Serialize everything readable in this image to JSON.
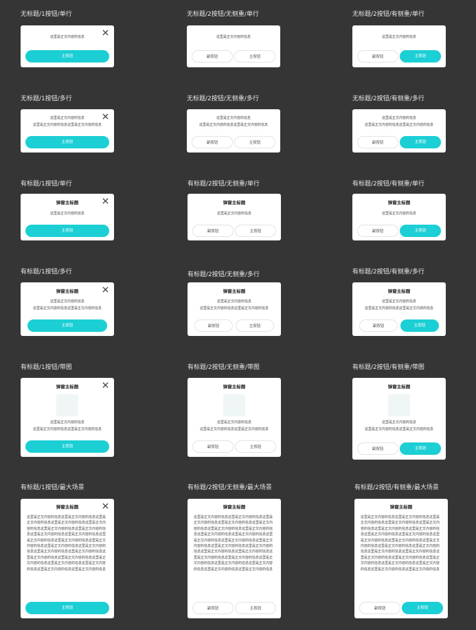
{
  "labels": {
    "r1c1": "无标题/1按钮/单行",
    "r1c2": "无标题/2按钮/无侧重/单行",
    "r1c3": "无标题/2按钮/有侧重/单行",
    "r2c1": "无标题/1按钮/多行",
    "r2c2": "无标题/2按钮/无侧重/多行",
    "r2c3": "无标题/2按钮/有侧重/多行",
    "r3c1": "有标题/1按钮/单行",
    "r3c2": "有标题/2按钮/无侧重/单行",
    "r3c3": "有标题/2按钮/有侧重/单行",
    "r4c1": "有标题/1按钮/多行",
    "r4c2": "有标题/2按钮/无侧重/多行",
    "r4c3": "有标题/2按钮/有侧重/多行",
    "r5c1": "有标题/1按钮/带图",
    "r5c2": "有标题/2按钮/无侧重/带图",
    "r5c3": "有标题/2按钮/有侧重/带图",
    "r6c1": "有标题/1按钮/最大场景",
    "r6c2": "有标题/2按钮/无侧重/最大场景",
    "r6c3": "有标题/2按钮/有侧重/最大场景"
  },
  "dialog": {
    "title": "弹窗主标题",
    "line1": "这里是正文内容的信息",
    "line2": "这里是正文内容的信息这里是正文内容的信息",
    "long_text": "这里是正文内容的信息这里是正文内容的信息这里是正文内容的信息这里是正文内容的信息这里是正文内容的信息这里是正文内容的信息这里是正文内容的信息这里是正文内容的信息这里是正文内容的信息这里是正文内容的信息这里是正文内容的信息这里是正文内容的信息这里是正文内容的信息这里是正文内容的信息这里是正文内容的信息这里是正文内容的信息这里是正文内容的信息这里是正文内容的信息这里是正文内容的信息这里是正文内容的信息这里是正文内容的信息这里是正文内容的信息这里是正文内容的信息",
    "primary": "主按钮",
    "secondary": "副按钮"
  },
  "colors": {
    "background": "#353535",
    "accent": "#1bcfd5",
    "dialog_bg": "#ffffff"
  },
  "icons": {
    "close": "close-icon"
  }
}
